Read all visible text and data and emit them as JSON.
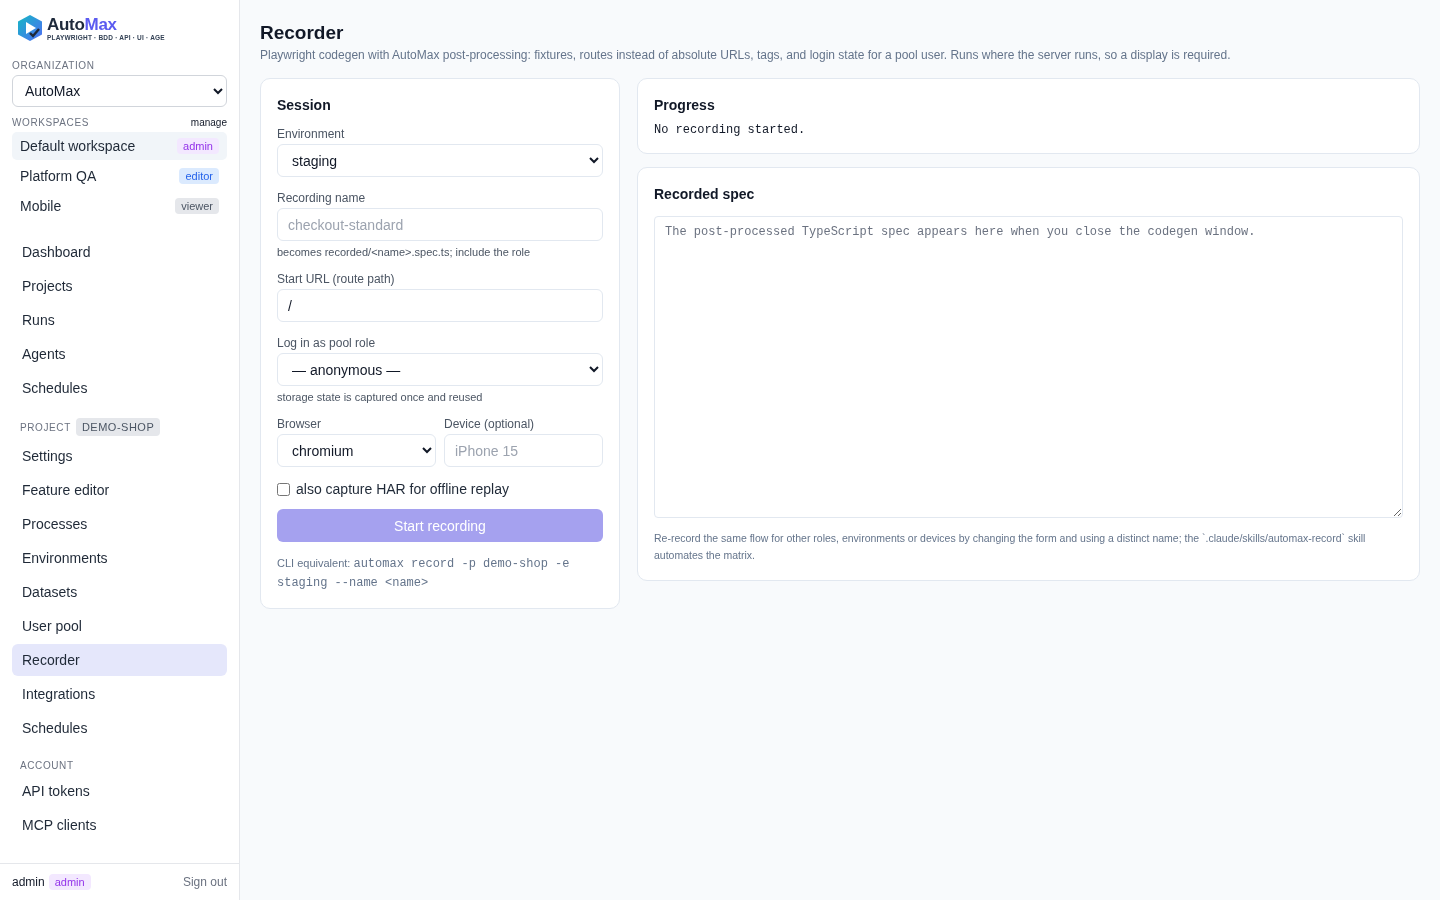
{
  "brand": {
    "name_a": "Auto",
    "name_b": "Max",
    "tagline": "PLAYWRIGHT · BDD · API · UI · AGE"
  },
  "organization": {
    "label": "ORGANIZATION",
    "value": "AutoMax"
  },
  "workspaces": {
    "label": "WORKSPACES",
    "manage": "manage",
    "items": [
      {
        "name": "Default workspace",
        "role": "admin",
        "selected": true
      },
      {
        "name": "Platform QA",
        "role": "editor",
        "selected": false
      },
      {
        "name": "Mobile",
        "role": "viewer",
        "selected": false
      }
    ]
  },
  "nav": [
    {
      "label": "Dashboard",
      "selected": false
    },
    {
      "label": "Projects",
      "selected": false
    },
    {
      "label": "Runs",
      "selected": false
    },
    {
      "label": "Agents",
      "selected": false
    },
    {
      "label": "Schedules",
      "selected": false
    }
  ],
  "project": {
    "label": "PROJECT",
    "badge": "DEMO-SHOP",
    "items": [
      {
        "label": "Settings",
        "selected": false
      },
      {
        "label": "Feature editor",
        "selected": false
      },
      {
        "label": "Processes",
        "selected": false
      },
      {
        "label": "Environments",
        "selected": false
      },
      {
        "label": "Datasets",
        "selected": false
      },
      {
        "label": "User pool",
        "selected": false
      },
      {
        "label": "Recorder",
        "selected": true
      },
      {
        "label": "Integrations",
        "selected": false
      },
      {
        "label": "Schedules",
        "selected": false
      }
    ]
  },
  "account": {
    "label": "ACCOUNT",
    "items": [
      {
        "label": "API tokens",
        "selected": false
      },
      {
        "label": "MCP clients",
        "selected": false
      }
    ]
  },
  "footer": {
    "user": "admin",
    "role": "admin",
    "sign_out": "Sign out"
  },
  "page": {
    "title": "Recorder",
    "subtitle": "Playwright codegen with AutoMax post-processing: fixtures, routes instead of absolute URLs, tags, and login state for a pool user. Runs where the server runs, so a display is required."
  },
  "session": {
    "title": "Session",
    "environment": {
      "label": "Environment",
      "value": "staging"
    },
    "recording_name": {
      "label": "Recording name",
      "placeholder": "checkout-standard",
      "hint": "becomes recorded/<name>.spec.ts; include the role"
    },
    "start_url": {
      "label": "Start URL (route path)",
      "value": "/"
    },
    "pool_role": {
      "label": "Log in as pool role",
      "value": "— anonymous —",
      "hint": "storage state is captured once and reused"
    },
    "browser": {
      "label": "Browser",
      "value": "chromium"
    },
    "device": {
      "label": "Device (optional)",
      "placeholder": "iPhone 15"
    },
    "har": {
      "label": "also capture HAR for offline replay",
      "checked": false
    },
    "start_button": {
      "label": "Start recording",
      "disabled": true
    },
    "cli_label": "CLI equivalent:",
    "cli_command": "automax record -p demo-shop -e staging --name <name>"
  },
  "progress": {
    "title": "Progress",
    "text": "No recording started."
  },
  "recorded_spec": {
    "title": "Recorded spec",
    "placeholder": "The post-processed TypeScript spec appears here when you close the codegen window.",
    "note": "Re-record the same flow for other roles, environments or devices by changing the form and using a distinct name; the `.claude/skills/automax-record` skill automates the matrix."
  }
}
